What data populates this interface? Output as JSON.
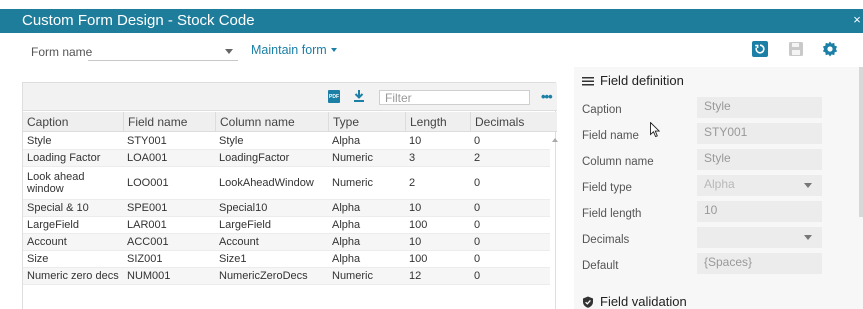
{
  "window": {
    "title": "Custom Form Design - Stock Code",
    "close_glyph": "×"
  },
  "toolbar": {
    "form_name_label": "Form name",
    "form_name_value": "",
    "maintain_label": "Maintain form",
    "icons": [
      "refresh-icon",
      "save-icon",
      "gear-icon"
    ],
    "accent_color": "#1b7fa6"
  },
  "grid": {
    "pdf_label": "PDF",
    "filter_placeholder": "Filter",
    "more_glyph": "•••",
    "columns": [
      "Caption",
      "Field name",
      "Column name",
      "Type",
      "Length",
      "Decimals"
    ],
    "rows": [
      [
        "Style",
        "STY001",
        "Style",
        "Alpha",
        "10",
        "0"
      ],
      [
        "Loading Factor",
        "LOA001",
        "LoadingFactor",
        "Numeric",
        "3",
        "2"
      ],
      [
        "Look ahead window",
        "LOO001",
        "LookAheadWindow",
        "Numeric",
        "2",
        "0"
      ],
      [
        "Special & 10",
        "SPE001",
        "Special10",
        "Alpha",
        "10",
        "0"
      ],
      [
        "LargeField",
        "LAR001",
        "LargeField",
        "Alpha",
        "100",
        "0"
      ],
      [
        "Account",
        "ACC001",
        "Account",
        "Alpha",
        "10",
        "0"
      ],
      [
        "Size",
        "SIZ001",
        "Size1",
        "Alpha",
        "100",
        "0"
      ],
      [
        "Numeric zero decs",
        "NUM001",
        "NumericZeroDecs",
        "Numeric",
        "12",
        "0"
      ]
    ]
  },
  "field_definition": {
    "title": "Field definition",
    "fields": [
      {
        "label": "Caption",
        "value": "Style",
        "dropdown": false
      },
      {
        "label": "Field name",
        "value": "STY001",
        "dropdown": false
      },
      {
        "label": "Column name",
        "value": "Style",
        "dropdown": false
      },
      {
        "label": "Field type",
        "value": "Alpha",
        "dropdown": true
      },
      {
        "label": "Field length",
        "value": "10",
        "dropdown": false
      },
      {
        "label": "Decimals",
        "value": "",
        "dropdown": true
      },
      {
        "label": "Default",
        "value": "{Spaces}",
        "dropdown": false
      }
    ]
  },
  "field_validation": {
    "title": "Field validation"
  }
}
